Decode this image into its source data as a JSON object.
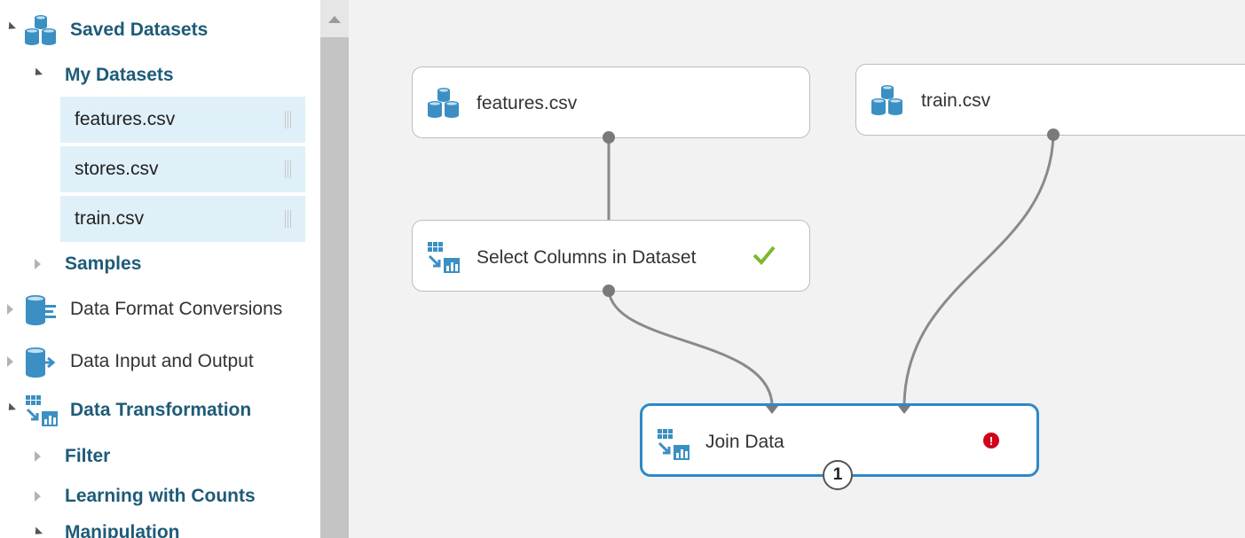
{
  "sidebar": {
    "saved_datasets": {
      "label": "Saved Datasets",
      "icon": "datasets-icon"
    },
    "my_datasets": {
      "label": "My Datasets"
    },
    "dataset_items": [
      {
        "label": "features.csv"
      },
      {
        "label": "stores.csv"
      },
      {
        "label": "train.csv"
      }
    ],
    "samples": {
      "label": "Samples"
    },
    "data_format_conversions": {
      "label": "Data Format Conversions",
      "icon": "data-format-icon"
    },
    "data_input_output": {
      "label": "Data Input and Output",
      "icon": "data-input-output-icon"
    },
    "data_transformation": {
      "label": "Data Transformation",
      "icon": "transform-icon"
    },
    "filter": {
      "label": "Filter"
    },
    "learning_with_counts": {
      "label": "Learning with Counts"
    },
    "manipulation": {
      "label": "Manipulation"
    }
  },
  "canvas": {
    "modules": {
      "features": {
        "label": "features.csv",
        "icon": "dataset-icon"
      },
      "train": {
        "label": "train.csv",
        "icon": "dataset-icon"
      },
      "select_columns": {
        "label": "Select Columns in Dataset",
        "icon": "transform-icon",
        "status": "success"
      },
      "join_data": {
        "label": "Join Data",
        "icon": "transform-icon",
        "status": "error",
        "badge": "1"
      }
    }
  },
  "colors": {
    "accent": "#2d89c8",
    "tree_text": "#1e5b78",
    "selected_bg": "#dff0f8",
    "success": "#7cb82f",
    "error": "#d0021b"
  }
}
